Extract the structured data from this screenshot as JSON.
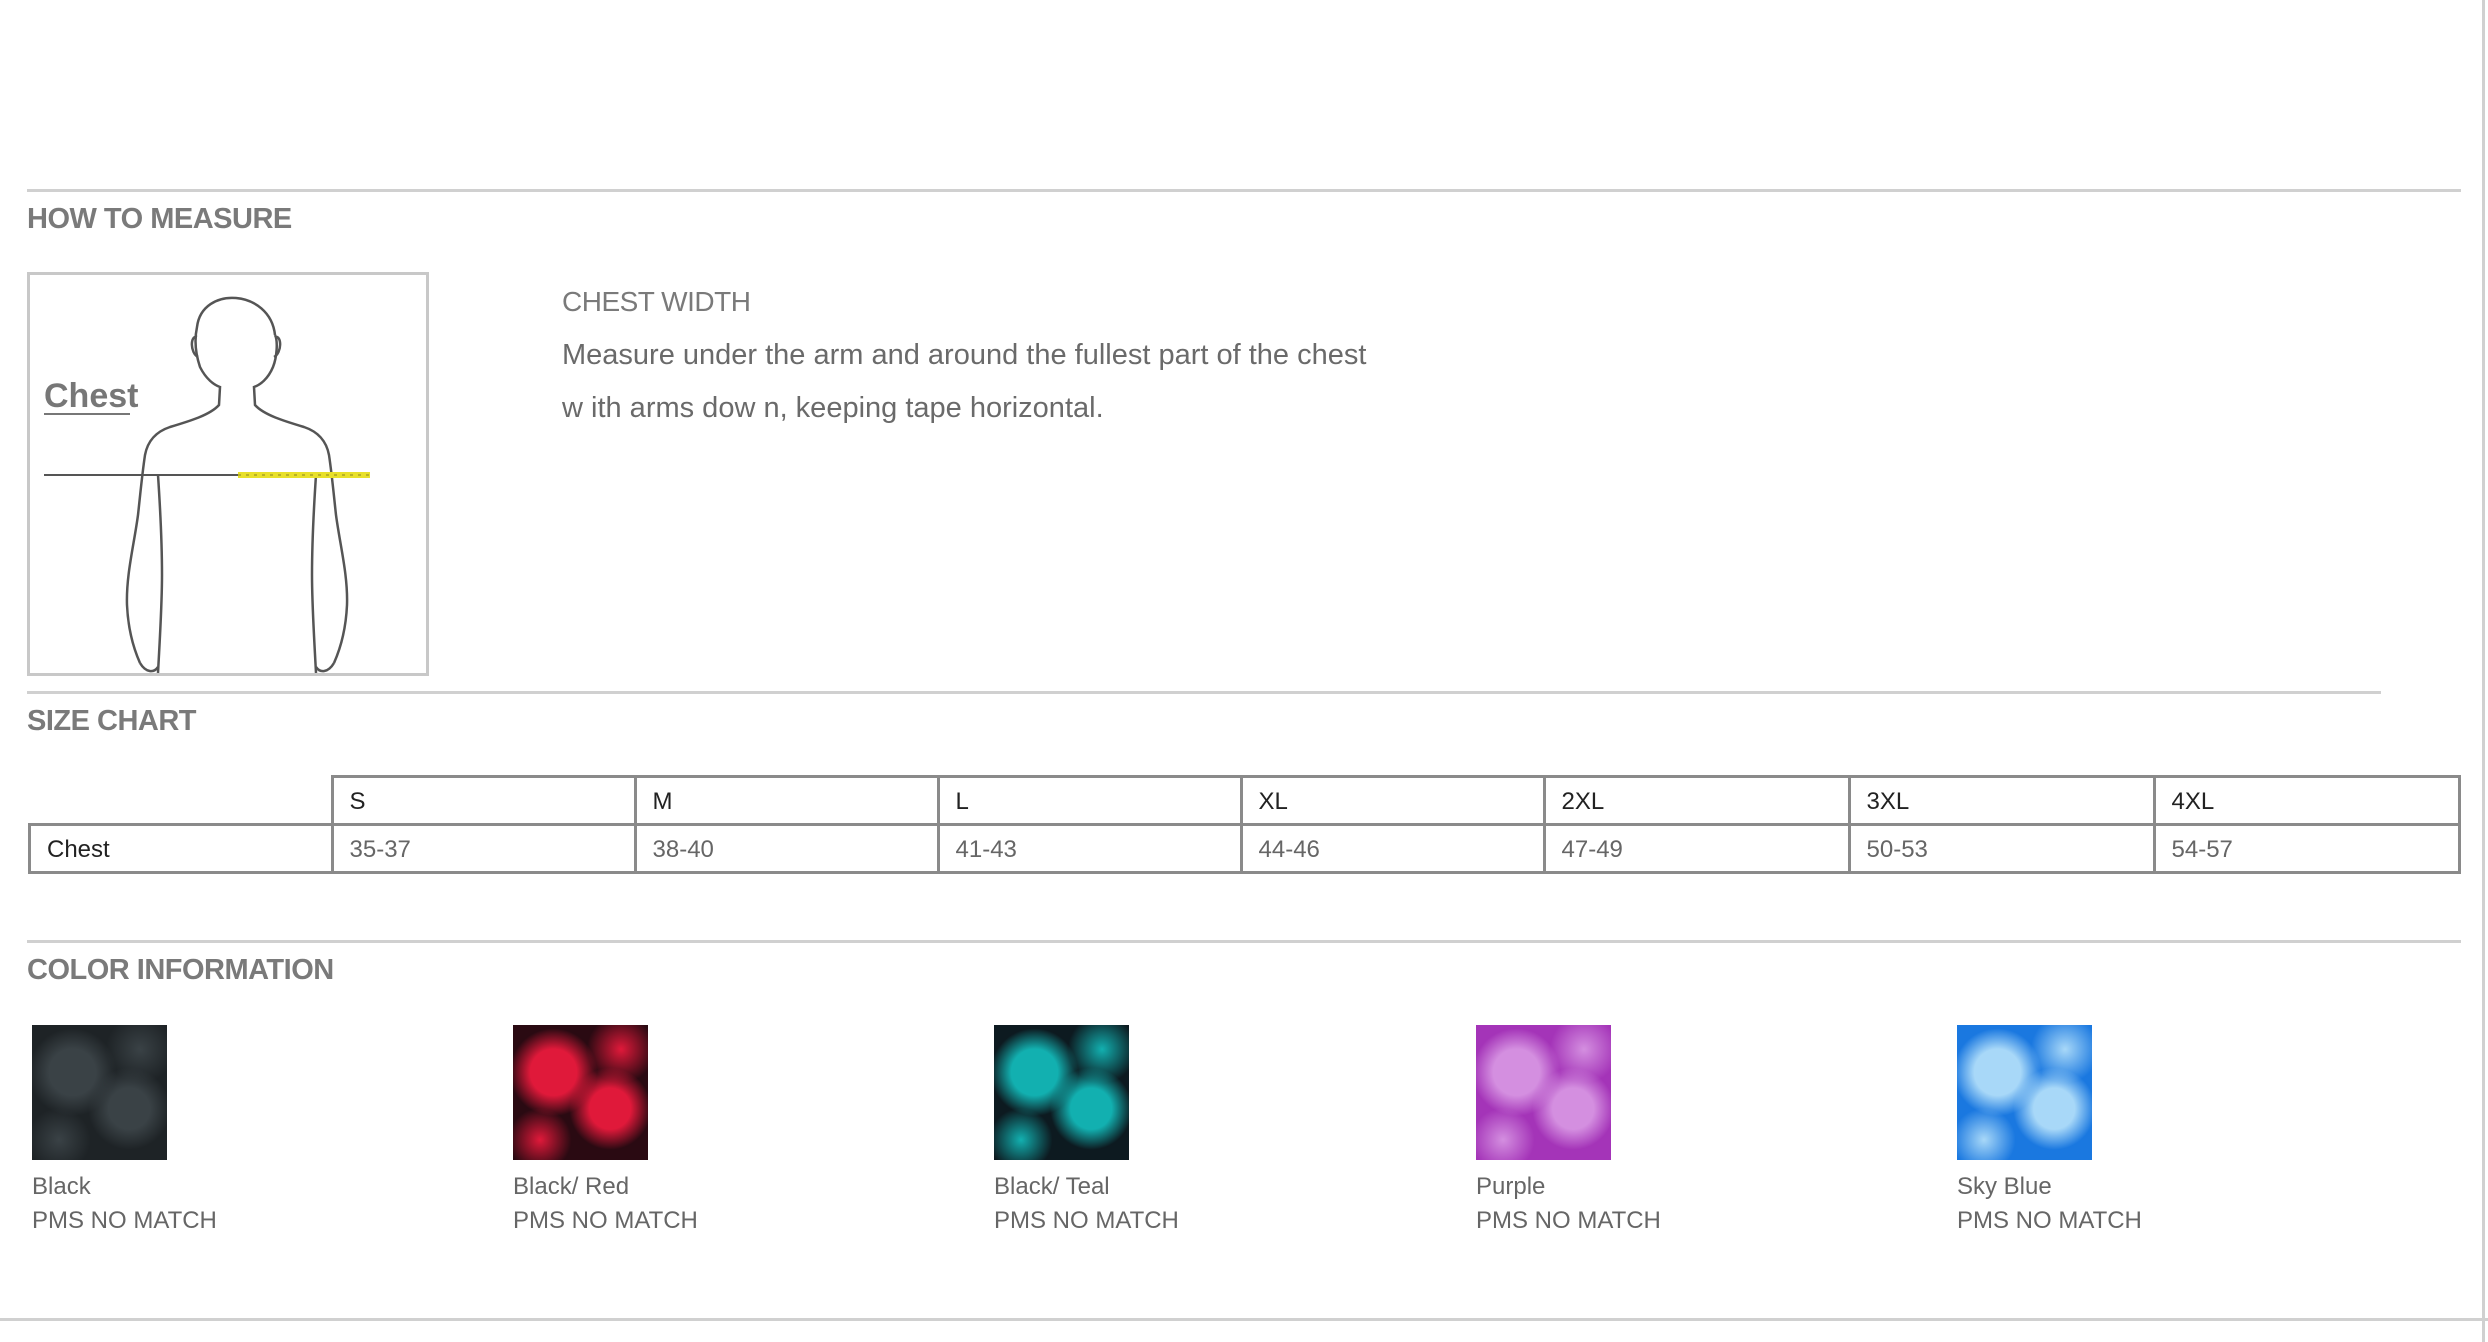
{
  "sections": {
    "how_to_measure": "HOW TO MEASURE",
    "size_chart": "SIZE CHART",
    "color_information": "COLOR INFORMATION"
  },
  "figure": {
    "label": "Chest",
    "tape_color": "#e8e02a"
  },
  "measure": {
    "heading": "CHEST WIDTH",
    "line1": "Measure under the arm and around the fullest part of the chest",
    "line2": "w ith arms dow n, keeping tape horizontal."
  },
  "size_table": {
    "headers": [
      "S",
      "M",
      "L",
      "XL",
      "2XL",
      "3XL",
      "4XL"
    ],
    "rows": [
      {
        "label": "Chest",
        "values": [
          "35-37",
          "38-40",
          "41-43",
          "44-46",
          "47-49",
          "50-53",
          "54-57"
        ]
      }
    ]
  },
  "colors": [
    {
      "name": "Black",
      "pms": "PMS NO MATCH",
      "base": "#1e2326",
      "accent": "#3a4246"
    },
    {
      "name": "Black/ Red",
      "pms": "PMS NO MATCH",
      "base": "#2a0a12",
      "accent": "#e0193a"
    },
    {
      "name": "Black/ Teal",
      "pms": "PMS NO MATCH",
      "base": "#0d1a20",
      "accent": "#12b0b0"
    },
    {
      "name": "Purple",
      "pms": "PMS NO MATCH",
      "base": "#a434b8",
      "accent": "#d48fe0"
    },
    {
      "name": "Sky  Blue",
      "pms": "PMS NO MATCH",
      "base": "#1a78e0",
      "accent": "#a8d8f8"
    }
  ]
}
